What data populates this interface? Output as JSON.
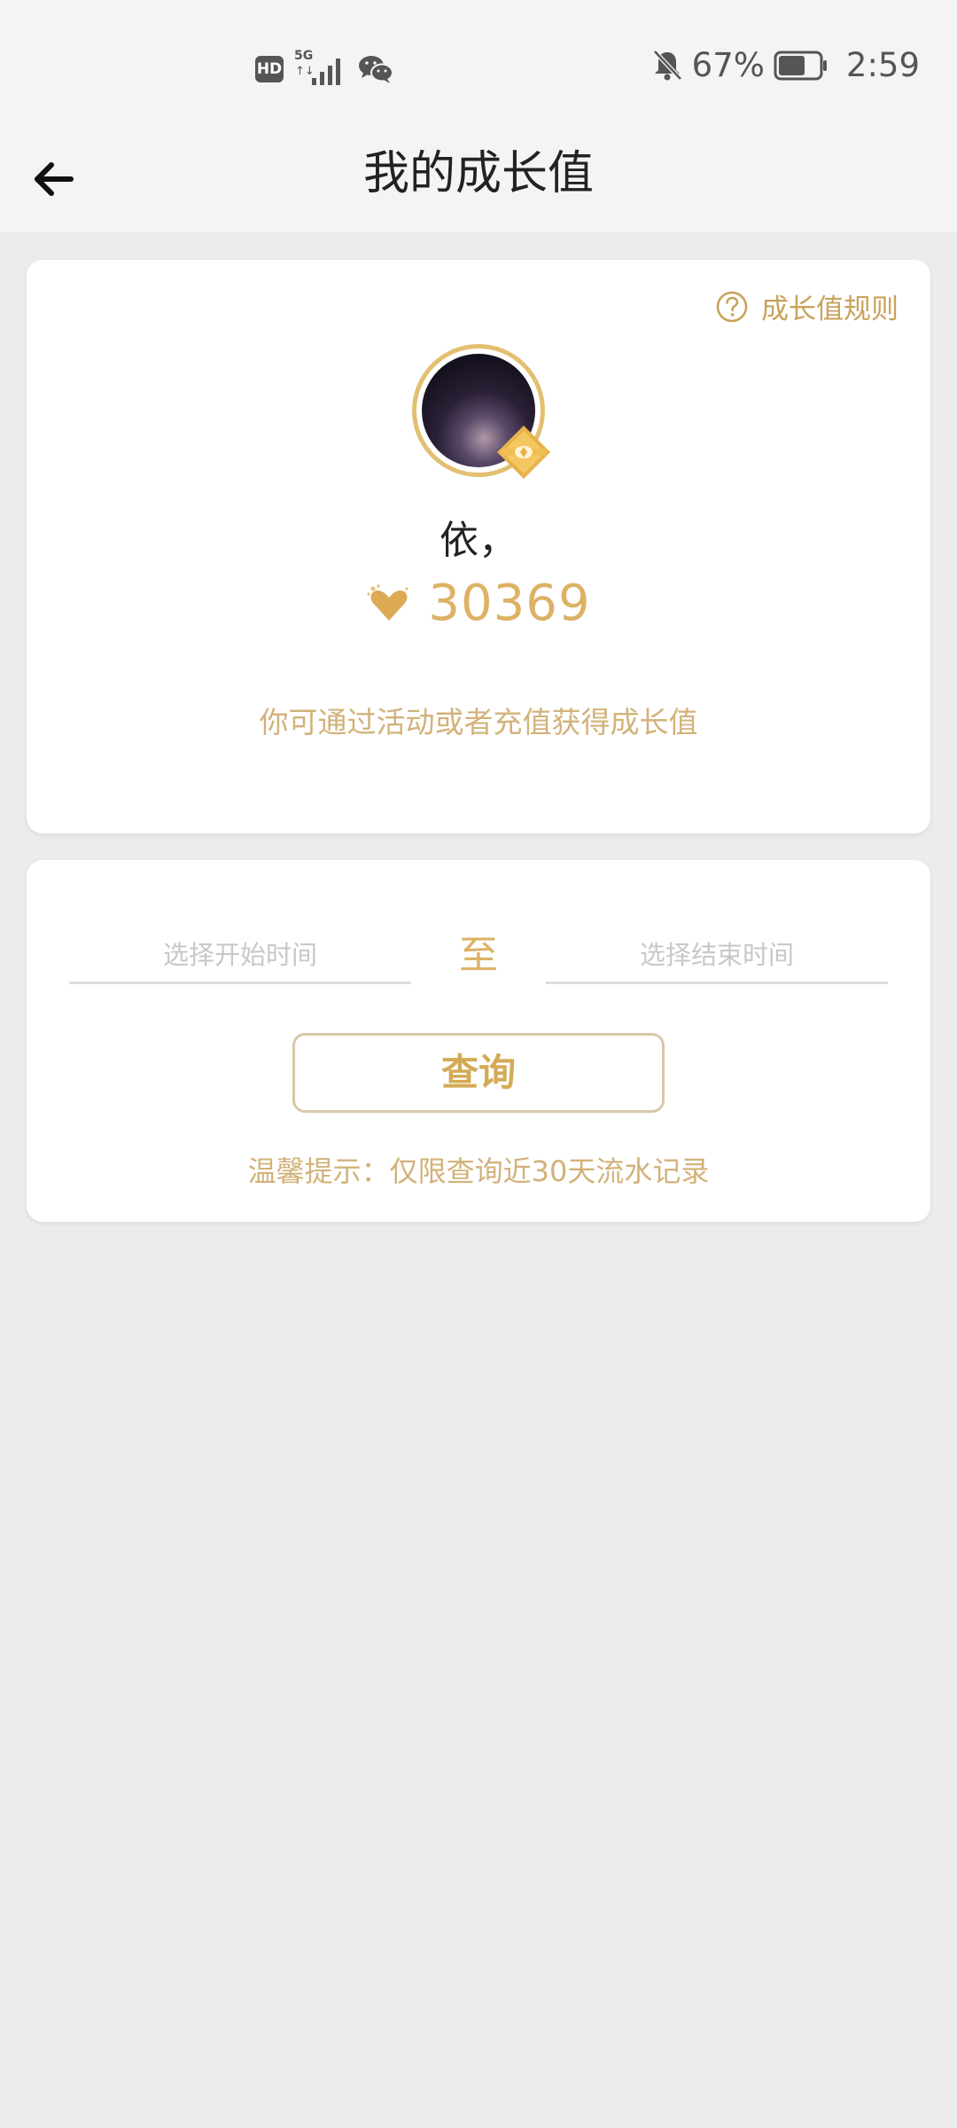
{
  "status_bar": {
    "hd_label": "HD",
    "network_label": "5G",
    "network_arrows": "↑↓",
    "battery_percent": "67%",
    "battery_level": 0.67,
    "time": "2:59",
    "icons": [
      "hd-icon",
      "signal-5g-icon",
      "wechat-icon",
      "mute-bell-icon",
      "battery-icon"
    ]
  },
  "header": {
    "title": "我的成长值",
    "back_icon": "arrow-left-icon"
  },
  "profile": {
    "rules_link": "成长值规则",
    "user_name": "依，",
    "growth_value": "30369",
    "hint": "你可通过活动或者充值获得成长值",
    "accent_color": "#dcb265"
  },
  "query": {
    "start_placeholder": "选择开始时间",
    "separator": "至",
    "end_placeholder": "选择结束时间",
    "button_label": "查询",
    "tip": "温馨提示：仅限查询近30天流水记录"
  }
}
